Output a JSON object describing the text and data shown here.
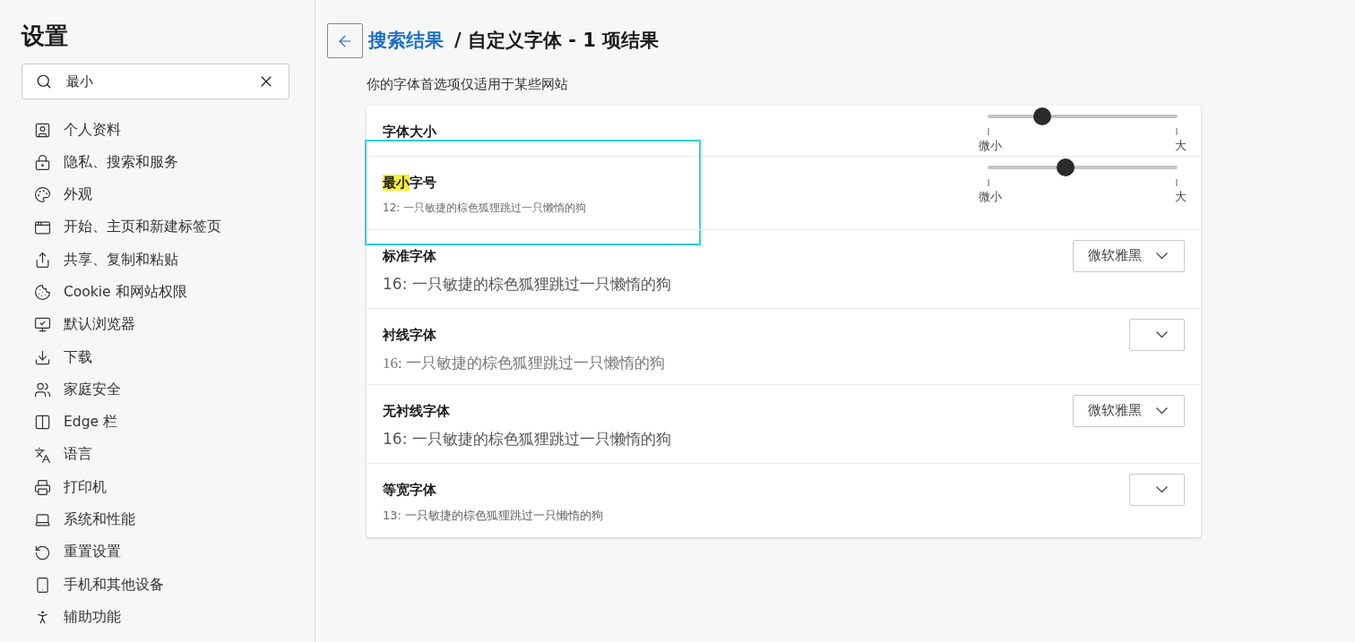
{
  "sidebar": {
    "title": "设置",
    "search": {
      "value": "最小"
    },
    "items": [
      {
        "label": "个人资料"
      },
      {
        "label": "隐私、搜索和服务"
      },
      {
        "label": "外观"
      },
      {
        "label": "开始、主页和新建标签页"
      },
      {
        "label": "共享、复制和粘贴"
      },
      {
        "label": "Cookie 和网站权限"
      },
      {
        "label": "默认浏览器"
      },
      {
        "label": "下载"
      },
      {
        "label": "家庭安全"
      },
      {
        "label": "Edge 栏"
      },
      {
        "label": "语言"
      },
      {
        "label": "打印机"
      },
      {
        "label": "系统和性能"
      },
      {
        "label": "重置设置"
      },
      {
        "label": "手机和其他设备"
      },
      {
        "label": "辅助功能"
      }
    ]
  },
  "header": {
    "link": "搜索结果",
    "title": "/ 自定义字体 - 1 项结果"
  },
  "note": "你的字体首选项仅适用于某些网站",
  "rows": [
    {
      "kind": "slider",
      "label_highlight": "",
      "label": "字体大小",
      "highlighted": false,
      "level": 0.29,
      "min_label": "微小",
      "max_label": "大"
    },
    {
      "kind": "slider",
      "label_highlight": "最小",
      "label": "字号",
      "highlighted": true,
      "sample": {
        "kind": "small",
        "text": "12: 一只敏捷的棕色狐狸跳过一只懒惰的狗"
      },
      "level": 0.41,
      "min_label": "微小",
      "max_label": "大"
    },
    {
      "kind": "select",
      "label": "标准字体",
      "highlighted": false,
      "sample": {
        "kind": "sans",
        "text": "16: 一只敏捷的棕色狐狸跳过一只懒惰的狗"
      },
      "value": "微软雅黑"
    },
    {
      "kind": "select",
      "label": "衬线字体",
      "highlighted": false,
      "sample": {
        "kind": "serif",
        "text": "16: 一只敏捷的棕色狐狸跳过一只懒惰的狗"
      }
    },
    {
      "kind": "select",
      "label": "无衬线字体",
      "highlighted": false,
      "sample": {
        "kind": "sans",
        "text": "16: 一只敏捷的棕色狐狸跳过一只懒惰的狗"
      },
      "value": "微软雅黑"
    },
    {
      "kind": "select",
      "label": "等宽字体",
      "highlighted": false,
      "sample": {
        "kind": "mono",
        "text": "13: 一只敏捷的棕色狐狸跳过一只懒惰的狗"
      }
    }
  ]
}
